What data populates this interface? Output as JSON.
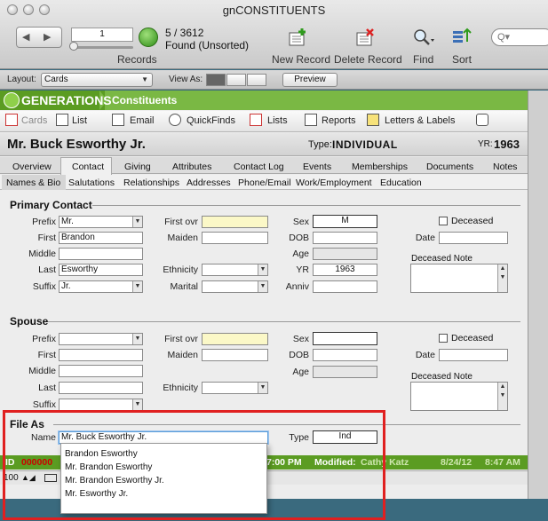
{
  "window": {
    "title": "gnCONSTITUENTS"
  },
  "toolbar": {
    "record_number": "1",
    "found_count": "5 / 3612",
    "found_label": "Found (Unsorted)",
    "records_label": "Records",
    "new_record": "New Record",
    "delete_record": "Delete Record",
    "find": "Find",
    "sort": "Sort",
    "search_placeholder": "Q▾"
  },
  "layout_bar": {
    "layout_label": "Layout:",
    "layout_value": "Cards",
    "view_as_label": "View As:",
    "preview": "Preview"
  },
  "header": {
    "brand": "GENERATIONS",
    "section": "Constituents"
  },
  "nav": {
    "cards": "Cards",
    "list": "List",
    "email": "Email",
    "quickfinds": "QuickFinds",
    "lists": "Lists",
    "reports": "Reports",
    "letters": "Letters & Labels"
  },
  "record": {
    "name": "Mr. Buck Esworthy Jr.",
    "type_label": "Type:",
    "type_value": "INDIVIDUAL",
    "yr_label": "YR:",
    "yr_value": "1963"
  },
  "tabs": [
    "Overview",
    "Contact",
    "Giving",
    "Attributes",
    "Contact Log",
    "Events",
    "Memberships",
    "Documents",
    "Notes"
  ],
  "subtabs": [
    "Names & Bio",
    "Salutations",
    "Relationships",
    "Addresses",
    "Phone/Email",
    "Work/Employment",
    "Education"
  ],
  "primary": {
    "title": "Primary Contact",
    "prefix_label": "Prefix",
    "prefix": "Mr.",
    "first_label": "First",
    "first": "Brandon",
    "middle_label": "Middle",
    "middle": "",
    "last_label": "Last",
    "last": "Esworthy",
    "suffix_label": "Suffix",
    "suffix": "Jr.",
    "first_ovr_label": "First ovr",
    "maiden_label": "Maiden",
    "ethnicity_label": "Ethnicity",
    "marital_label": "Marital",
    "sex_label": "Sex",
    "sex": "M",
    "dob_label": "DOB",
    "age_label": "Age",
    "yr_label": "YR",
    "yr": "1963",
    "anniv_label": "Anniv",
    "deceased_label": "Deceased",
    "date_label": "Date",
    "deceased_note_label": "Deceased Note"
  },
  "spouse": {
    "title": "Spouse",
    "prefix_label": "Prefix",
    "first_label": "First",
    "middle_label": "Middle",
    "last_label": "Last",
    "suffix_label": "Suffix",
    "first_ovr_label": "First ovr",
    "maiden_label": "Maiden",
    "ethnicity_label": "Ethnicity",
    "sex_label": "Sex",
    "dob_label": "DOB",
    "age_label": "Age",
    "deceased_label": "Deceased",
    "date_label": "Date",
    "deceased_note_label": "Deceased Note"
  },
  "file_as": {
    "title": "File As",
    "name_label": "Name",
    "name_value": "Mr. Buck Esworthy Jr.",
    "type_label": "Type",
    "type_value": "Ind",
    "options": [
      "Brandon Esworthy",
      "Mr. Brandon Esworthy",
      "Mr. Brandon Esworthy Jr.",
      "Mr. Esworthy Jr."
    ]
  },
  "status": {
    "id_label": "ID",
    "id_value": "000000",
    "time": "7:00 PM",
    "modified_label": "Modified:",
    "modified_by": "Cathy Katz",
    "modified_date": "8/24/12",
    "modified_time": "8:47 AM",
    "zoom": "100"
  }
}
